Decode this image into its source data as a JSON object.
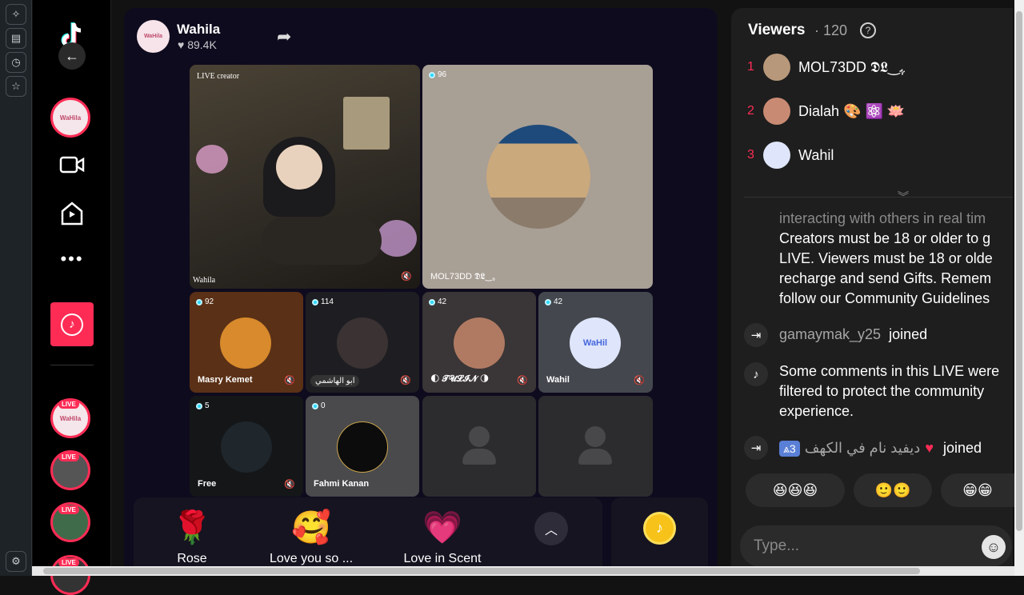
{
  "host": {
    "name": "Wahila",
    "likes": "89.4K",
    "avatar_text": "WaHila"
  },
  "tiles": [
    {
      "id": "main",
      "label": "LIVE creator",
      "name": "Wahila"
    },
    {
      "id": "t2",
      "count": "96",
      "name": "MOL73DD 𝕯𝕷‿ﮩ"
    },
    {
      "id": "t3",
      "count": "92",
      "name": "Masry Kemet"
    },
    {
      "id": "t4",
      "count": "114",
      "name": "ابو الهاشمي"
    },
    {
      "id": "t5",
      "count": "42",
      "name": "🌓 𝓣𝓤𝓛𝓘𝓝 🌗"
    },
    {
      "id": "t6",
      "count": "42",
      "name": "Wahil",
      "avatar_text": "WaHil"
    },
    {
      "id": "t7",
      "count": "5",
      "name": "Free"
    },
    {
      "id": "t8",
      "count": "0",
      "name": "Fahmi Kanan"
    }
  ],
  "gifts": [
    {
      "emoji": "🌹",
      "label": "Rose"
    },
    {
      "emoji": "🥰",
      "label": "Love you so ..."
    },
    {
      "emoji": "💗",
      "label": "Love in Scent"
    }
  ],
  "viewers": {
    "title": "Viewers",
    "count": "120",
    "list": [
      {
        "rank": "1",
        "name": "MOL73DD 𝕯𝕷‿ﮩ"
      },
      {
        "rank": "2",
        "name": "Dialah 🎨 ⚛️ 🪷"
      },
      {
        "rank": "3",
        "name": "Wahil"
      }
    ]
  },
  "chat": {
    "system_lines": [
      "interacting with others in real tim",
      "Creators must be 18 or older to g",
      "LIVE. Viewers must be 18 or olde",
      "recharge and send Gifts. Remem",
      "follow our Community Guidelines"
    ],
    "join1_user": "gamaymak_y25",
    "join_label": "joined",
    "filter_lines": [
      "Some comments in this LIVE were",
      "filtered to protect the community",
      "experience."
    ],
    "join2_level": "3",
    "join2_user": "ديفيد نام في الكهف",
    "emoji_chips": [
      "😆😆😆",
      "🙂🙂",
      "😁😁"
    ],
    "placeholder": "Type..."
  },
  "colors": {
    "accent": "#fe2c55",
    "bg": "#000000",
    "stage": "#0f0b1e"
  }
}
